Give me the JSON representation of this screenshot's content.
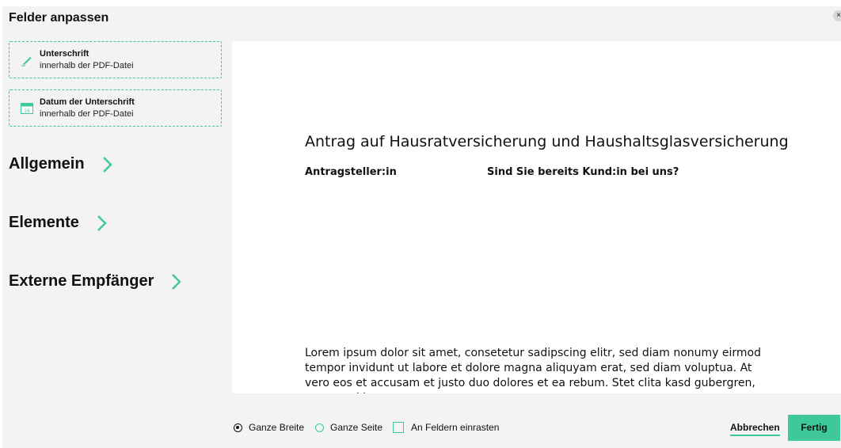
{
  "dialog": {
    "title": "Felder anpassen",
    "close_label": "×"
  },
  "fields": [
    {
      "title": "Unterschrift",
      "subtitle": "innerhalb der PDF-Datei",
      "icon": "pen-icon"
    },
    {
      "title": "Datum der Unterschrift",
      "subtitle": "innerhalb der PDF-Datei",
      "icon": "calendar-icon",
      "icon_number": "16"
    }
  ],
  "sections": [
    {
      "label": "Allgemein"
    },
    {
      "label": "Elemente"
    },
    {
      "label": "Externe Empfänger"
    }
  ],
  "document": {
    "title": "Antrag auf Hausratversicherung und Haushaltsglasversicherung",
    "applicant_label": "Antragsteller:in",
    "question": "Sind Sie bereits Kund:in bei uns?",
    "body": "Lorem ipsum dolor sit amet, consetetur sadipscing elitr, sed diam nonumy eirmod tempor invidunt ut labore et dolore magna aliquyam erat, sed diam voluptua. At vero eos et accusam et justo duo dolores et ea rebum. Stet clita kasd gubergren, no sea takimata"
  },
  "footer": {
    "options": [
      {
        "label": "Ganze Breite",
        "type": "radio",
        "checked": true
      },
      {
        "label": "Ganze Seite",
        "type": "radio",
        "checked": false
      },
      {
        "label": "An Feldern einrasten",
        "type": "checkbox",
        "checked": false
      }
    ],
    "cancel_label": "Abbrechen",
    "done_label": "Fertig"
  },
  "colors": {
    "accent": "#3fc99a",
    "background": "#f3f3f3",
    "document": "#ffffff"
  }
}
